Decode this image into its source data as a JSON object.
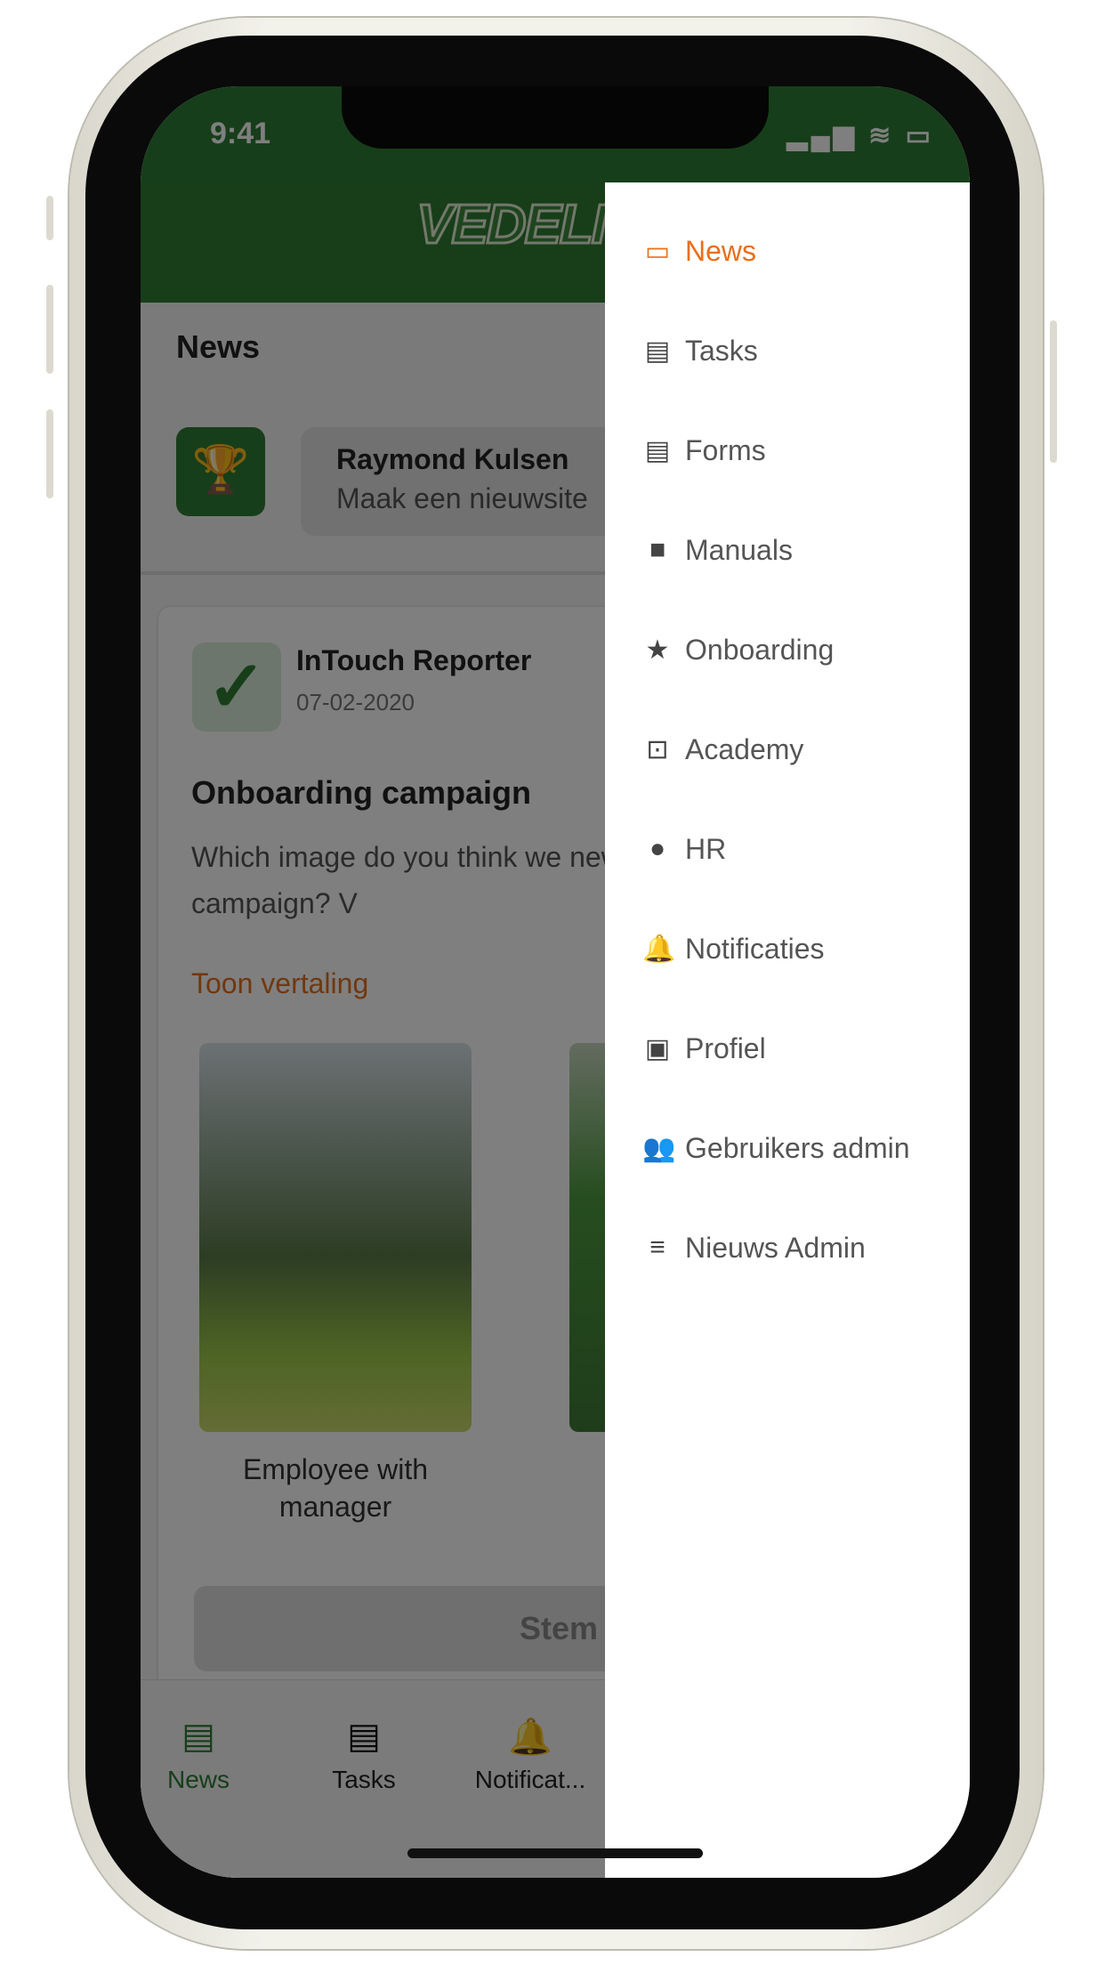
{
  "status_bar": {
    "time": "9:41",
    "icons": [
      "signal-icon",
      "wifi-icon",
      "battery-icon"
    ]
  },
  "header": {
    "logo": "VEDELI"
  },
  "main": {
    "section_title": "News",
    "chat": {
      "name": "Raymond Kulsen",
      "message": "Maak een nieuwsite"
    },
    "post": {
      "author": "InTouch Reporter",
      "date": "07-02-2020",
      "title": "Onboarding campaign",
      "body": "Which image do you think we new onboarding campaign? V",
      "translate_label": "Toon vertaling",
      "options": [
        {
          "caption": "Employee with manager"
        },
        {
          "caption": ""
        }
      ],
      "vote_label": "Stem"
    }
  },
  "tabbar": {
    "items": [
      {
        "label": "News",
        "icon": "news-icon",
        "active": true
      },
      {
        "label": "Tasks",
        "icon": "clipboard-icon"
      },
      {
        "label": "Notificat...",
        "icon": "bell-icon"
      }
    ]
  },
  "drawer": {
    "active_color": "#e86f1c",
    "items": [
      {
        "label": "News",
        "icon": "news-icon",
        "glyph": "▭",
        "active": true
      },
      {
        "label": "Tasks",
        "icon": "clipboard-icon",
        "glyph": "▤"
      },
      {
        "label": "Forms",
        "icon": "document-icon",
        "glyph": "▤"
      },
      {
        "label": "Manuals",
        "icon": "book-icon",
        "glyph": "■"
      },
      {
        "label": "Onboarding",
        "icon": "star-icon",
        "glyph": "★"
      },
      {
        "label": "Academy",
        "icon": "chip-icon",
        "glyph": "⊡"
      },
      {
        "label": "HR",
        "icon": "hr-icon",
        "glyph": "●"
      },
      {
        "label": "Notificaties",
        "icon": "bell-icon",
        "glyph": "🔔"
      },
      {
        "label": "Profiel",
        "icon": "profile-icon",
        "glyph": "▣"
      },
      {
        "label": "Gebruikers admin",
        "icon": "people-icon",
        "glyph": "👥"
      },
      {
        "label": "Nieuws Admin",
        "icon": "list-icon",
        "glyph": "≡"
      }
    ]
  },
  "colors": {
    "brand_green": "#2e7d32",
    "accent_orange": "#e86f1c"
  }
}
